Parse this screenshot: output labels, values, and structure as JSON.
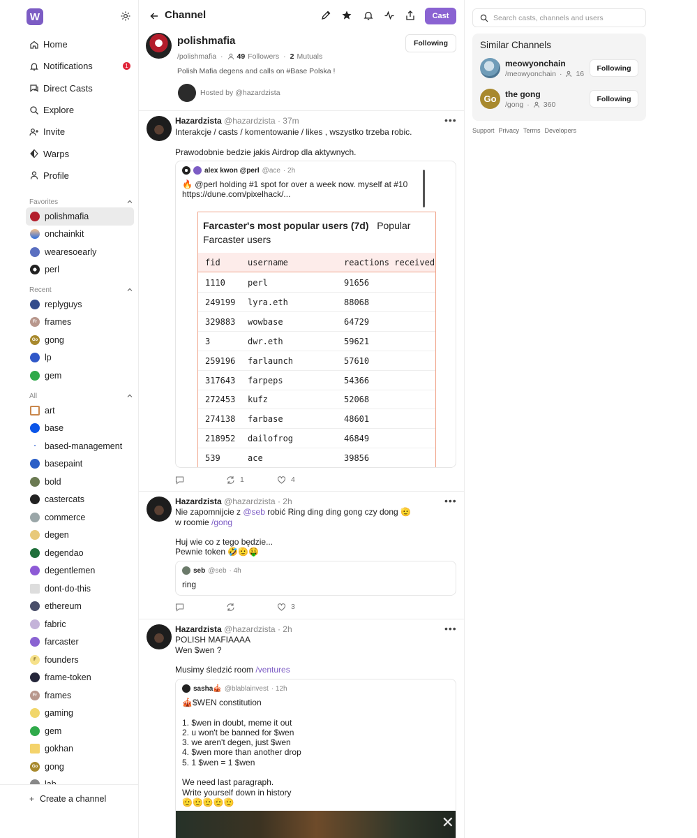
{
  "sidebar": {
    "logo": "W",
    "nav": [
      {
        "label": "Home",
        "icon": "home-icon"
      },
      {
        "label": "Notifications",
        "icon": "bell-icon",
        "badge": "1"
      },
      {
        "label": "Direct Casts",
        "icon": "chat-icon"
      },
      {
        "label": "Explore",
        "icon": "search-icon"
      },
      {
        "label": "Invite",
        "icon": "invite-icon"
      },
      {
        "label": "Warps",
        "icon": "diamond-icon"
      },
      {
        "label": "Profile",
        "icon": "person-icon"
      }
    ],
    "favorites_label": "Favorites",
    "favorites": [
      "polishmafia",
      "onchainkit",
      "wearesoearly",
      "perl"
    ],
    "recent_label": "Recent",
    "recent": [
      "replyguys",
      "frames",
      "gong",
      "lp",
      "gem"
    ],
    "all_label": "All",
    "all": [
      "art",
      "base",
      "based-management",
      "basepaint",
      "bold",
      "castercats",
      "commerce",
      "degen",
      "degendao",
      "degentlemen",
      "dont-do-this",
      "ethereum",
      "fabric",
      "farcaster",
      "founders",
      "frame-token",
      "frames",
      "gaming",
      "gem",
      "gokhan",
      "gong",
      "lab"
    ],
    "create_label": "Create a channel"
  },
  "header": {
    "title": "Channel",
    "cast_label": "Cast"
  },
  "channel": {
    "name": "polishmafia",
    "handle": "/polishmafia",
    "followers_count": "49",
    "followers_label": "Followers",
    "mutuals_count": "2",
    "mutuals_label": "Mutuals",
    "description": "Polish Mafia degens and calls on #Base Polska !",
    "hosted_by": "Hosted by @hazardzista",
    "follow_label": "Following"
  },
  "posts": [
    {
      "author": "Hazardzista",
      "handle": "@hazardzista",
      "time": "· 37m",
      "text": "Interakcje / casts / komentowanie / likes , wszystko trzeba robic.\n\nPrawodobnie bedzie jakis Airdrop dla aktywnych.",
      "quote": {
        "author": "alex kwon @perl",
        "handle": "@ace",
        "time": "· 2h",
        "text": "🔥 @perl holding #1 spot for over a week now. myself at #10\nhttps://dune.com/pixelhack/..."
      },
      "table": {
        "title_bold": "Farcaster's most popular users (7d)",
        "title_rest": "Popular Farcaster users",
        "columns": [
          "fid",
          "username",
          "reactions received"
        ],
        "rows": [
          [
            "1110",
            "perl",
            "91656"
          ],
          [
            "249199",
            "lyra.eth",
            "88068"
          ],
          [
            "329883",
            "wowbase",
            "64729"
          ],
          [
            "3",
            "dwr.eth",
            "59621"
          ],
          [
            "259196",
            "farlaunch",
            "57610"
          ],
          [
            "317643",
            "farpeps",
            "54366"
          ],
          [
            "272453",
            "kufz",
            "52068"
          ],
          [
            "274138",
            "farbase",
            "48601"
          ],
          [
            "218952",
            "dailofrog",
            "46849"
          ],
          [
            "539",
            "ace",
            "39856"
          ]
        ]
      },
      "recasts": "1",
      "likes": "4"
    },
    {
      "author": "Hazardzista",
      "handle": "@hazardzista",
      "time": "· 2h",
      "line1_pre": "Nie zapomnijcie z ",
      "line1_link": "@seb",
      "line1_post": " robić Ring ding ding gong czy dong 🫡",
      "line2_pre": "w roomie ",
      "line2_link": "/gong",
      "line3": "Huj wie co z tego będzie...",
      "line4": "Pewnie token 🤣🫡🤑",
      "quote": {
        "author": "seb",
        "handle": "@seb",
        "time": "· 4h",
        "text": "ring"
      },
      "recasts": "",
      "likes": "3"
    },
    {
      "author": "Hazardzista",
      "handle": "@hazardzista",
      "time": "· 2h",
      "text": "POLISH MAFIAAAA\nWen $wen ?",
      "line3_pre": "Musimy śledzić room ",
      "line3_link": "/ventures",
      "quote": {
        "author": "sasha🎪",
        "handle": "@blablainvest",
        "time": "· 12h",
        "text": "🎪$WEN constitution\n\n1. $wen in doubt, meme it out\n2. u won't be banned for $wen\n3. we aren't degen, just $wen\n4. $wen more than another drop\n5. 1 $wen = 1 $wen\n\nWe need last paragraph.\nWrite yourself down in history\n🫡🫡🫡🫡🫡"
      }
    }
  ],
  "right": {
    "search_placeholder": "Search casts, channels and users",
    "similar_title": "Similar Channels",
    "similar": [
      {
        "name": "meowyonchain",
        "handle": "/meowyonchain",
        "count": "16",
        "button": "Following"
      },
      {
        "name": "the gong",
        "handle": "/gong",
        "count": "360",
        "button": "Following",
        "avatar_text": "Go"
      }
    ],
    "footer": [
      "Support",
      "Privacy",
      "Terms",
      "Developers"
    ]
  },
  "colors": {
    "accent": "#8a63d2",
    "badge": "#e0263a",
    "table_border": "#f0a48a"
  }
}
